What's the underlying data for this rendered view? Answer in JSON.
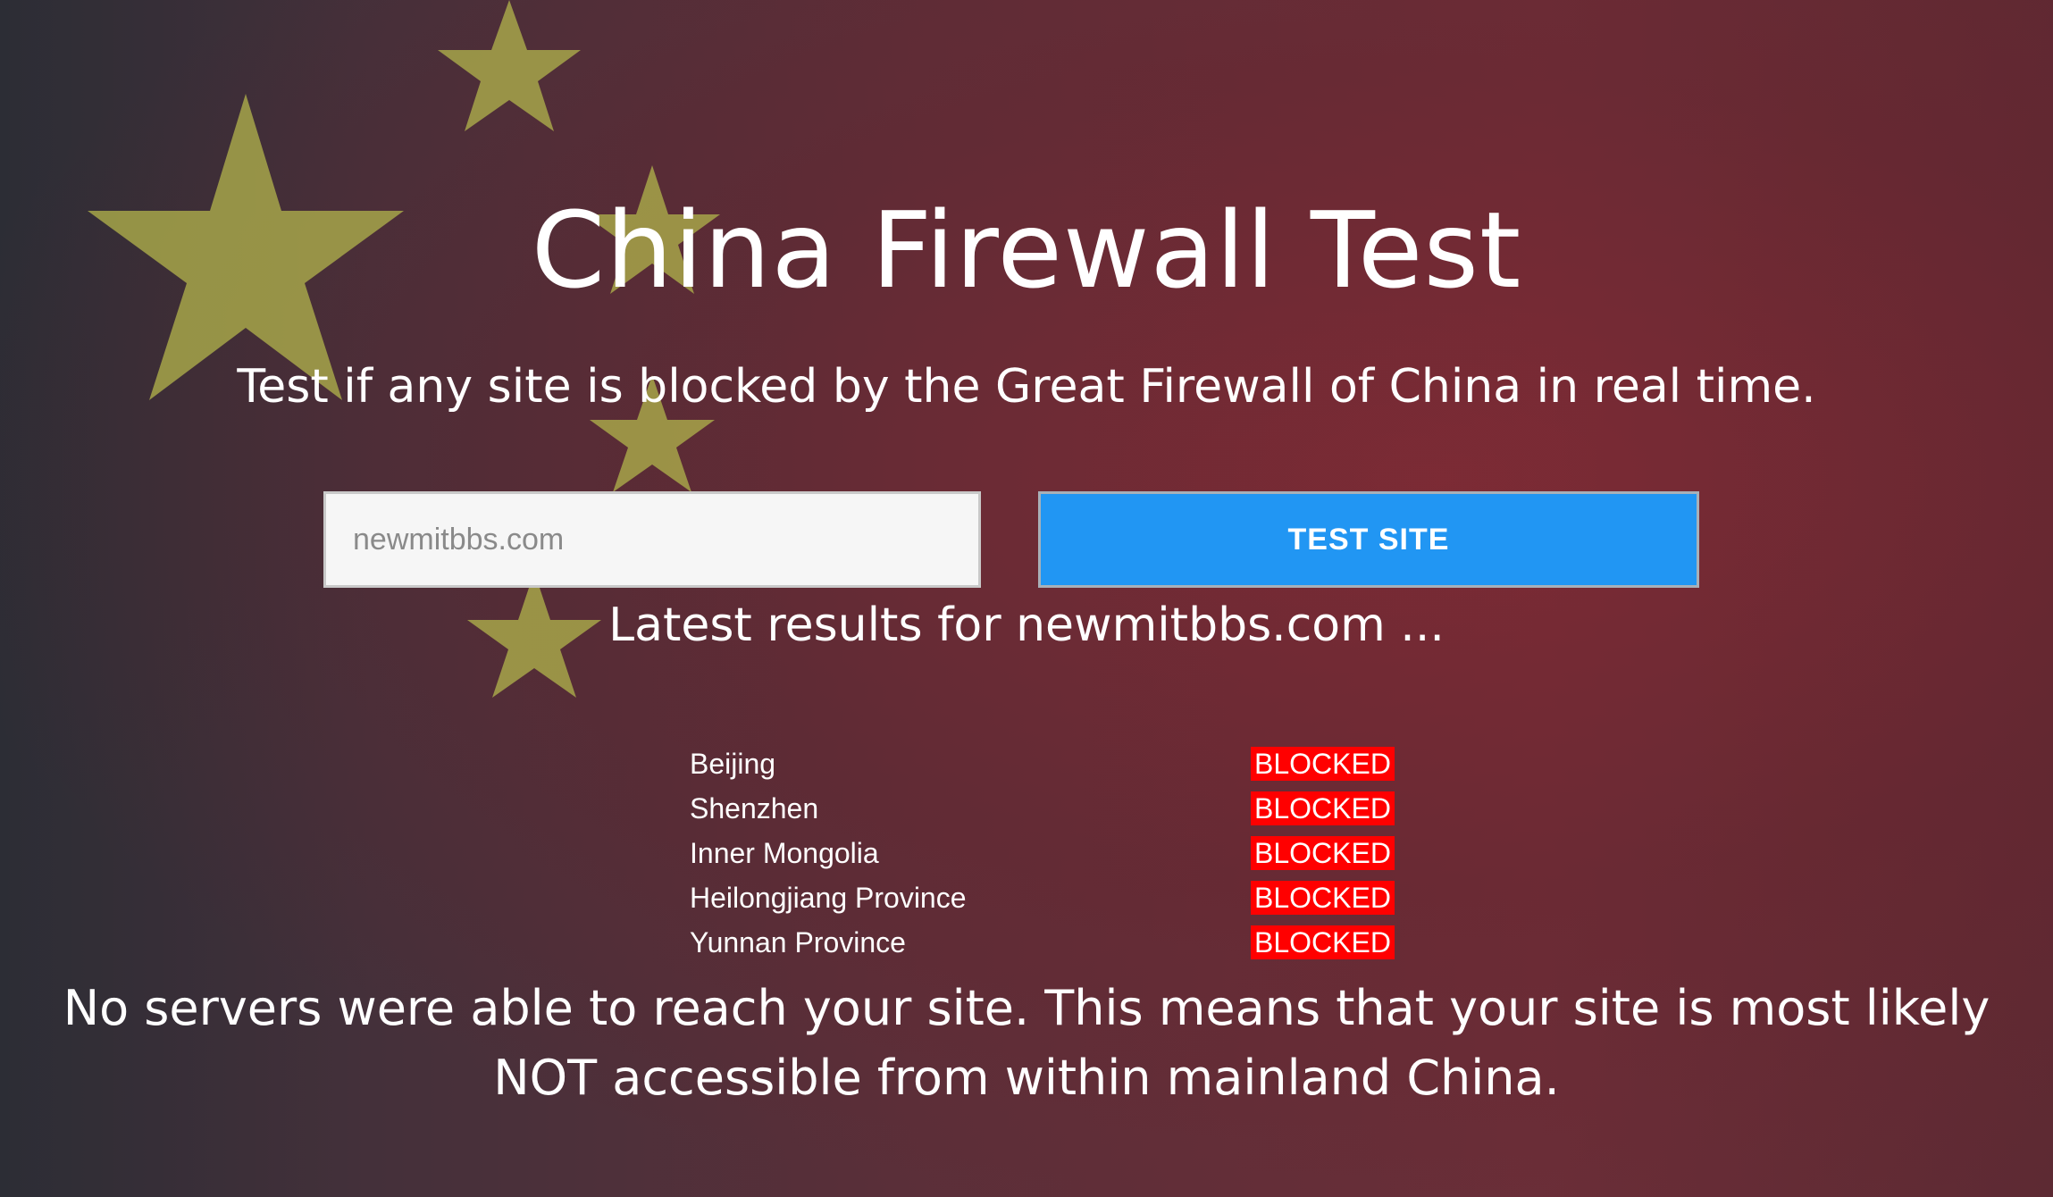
{
  "header": {
    "title": "China Firewall Test",
    "subtitle": "Test if any site is blocked by the Great Firewall of China in real time."
  },
  "form": {
    "site_value": "",
    "site_placeholder": "newmitbbs.com",
    "button_label": "TEST SITE"
  },
  "results": {
    "heading": "Latest results for newmitbbs.com ...",
    "rows": [
      {
        "city": "Beijing",
        "status": "BLOCKED"
      },
      {
        "city": "Shenzhen",
        "status": "BLOCKED"
      },
      {
        "city": "Inner Mongolia",
        "status": "BLOCKED"
      },
      {
        "city": "Heilongjiang Province",
        "status": "BLOCKED"
      },
      {
        "city": "Yunnan Province",
        "status": "BLOCKED"
      }
    ],
    "summary": "No servers were able to reach your site. This means that your site is most likely NOT accessible from within mainland China."
  },
  "colors": {
    "button": "#2196f3",
    "blocked_badge": "#ff0000",
    "star": "#a9a94a"
  }
}
